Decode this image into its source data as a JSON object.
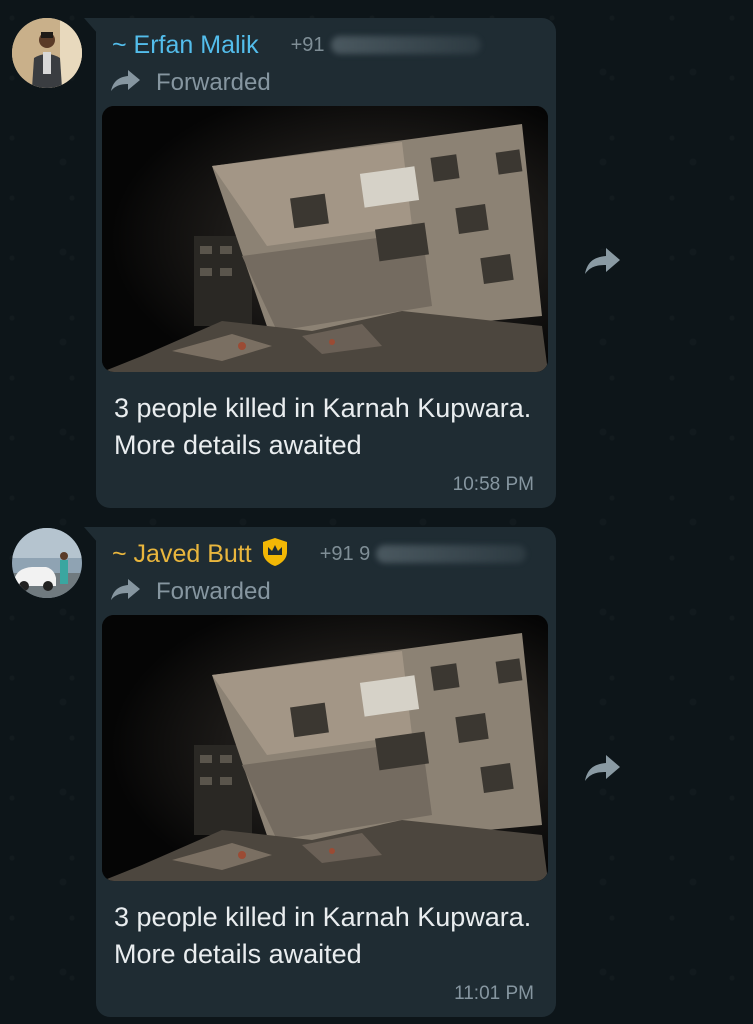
{
  "messages": [
    {
      "sender": "~ Erfan Malik",
      "sender_color": "#53bdeb",
      "phone_visible": "+91",
      "forwarded_label": "Forwarded",
      "caption": "3 people killed in Karnah Kupwara. More details awaited",
      "time": "10:58 PM",
      "has_badge": false
    },
    {
      "sender": "~ Javed Butt",
      "sender_color": "#e9b63d",
      "phone_visible": "+91 9",
      "forwarded_label": "Forwarded",
      "caption": "3 people killed in Karnah Kupwara. More details awaited",
      "time": "11:01 PM",
      "has_badge": true
    }
  ],
  "colors": {
    "background": "#0d1519",
    "bubble": "#1f2c33",
    "caption_text": "#e9edef",
    "meta_text": "#8696a0",
    "badge": "#f2b705"
  },
  "icons": {
    "forwarded": "forward-arrow-icon",
    "share": "share-forward-icon",
    "badge": "crown-shield-icon"
  }
}
